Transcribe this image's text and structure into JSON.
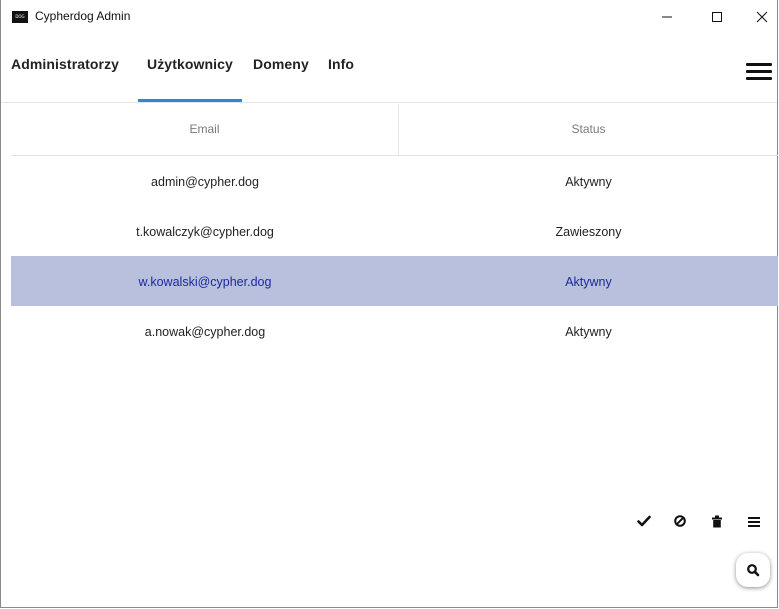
{
  "window": {
    "title": "Cypherdog Admin",
    "icon_text": "DOG"
  },
  "tabs": [
    {
      "label": "Administratorzy",
      "active": false
    },
    {
      "label": "Użytkownicy",
      "active": true
    },
    {
      "label": "Domeny",
      "active": false
    },
    {
      "label": "Info",
      "active": false
    }
  ],
  "table": {
    "columns": [
      "Email",
      "Status"
    ],
    "rows": [
      {
        "email": "admin@cypher.dog",
        "status": "Aktywny",
        "selected": false
      },
      {
        "email": "t.kowalczyk@cypher.dog",
        "status": "Zawieszony",
        "selected": false
      },
      {
        "email": "w.kowalski@cypher.dog",
        "status": "Aktywny",
        "selected": true
      },
      {
        "email": "a.nowak@cypher.dog",
        "status": "Aktywny",
        "selected": false
      }
    ]
  },
  "actions": [
    "check-icon",
    "block-icon",
    "trash-icon",
    "list-icon"
  ],
  "fab": {
    "icon": "search-icon"
  },
  "colors": {
    "accent": "#2f86d4",
    "selected_row": "#b8c0de",
    "selected_text": "#1a2a9a"
  }
}
